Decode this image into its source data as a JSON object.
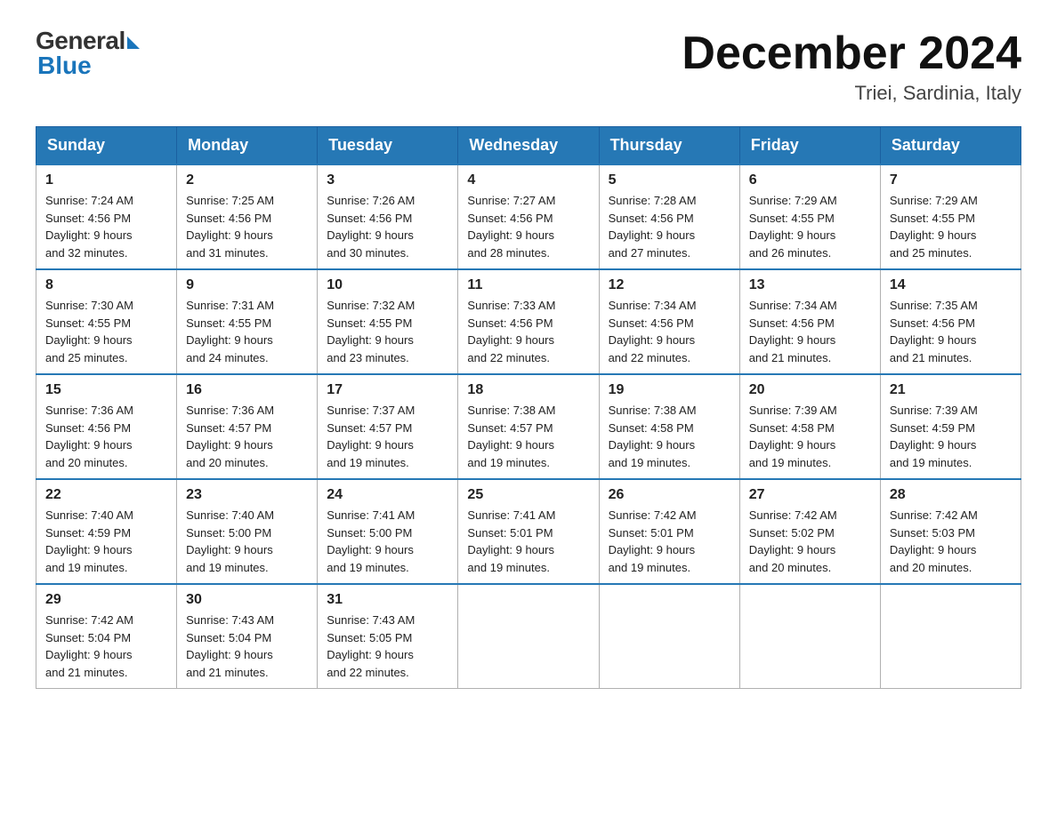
{
  "logo": {
    "general": "General",
    "blue": "Blue"
  },
  "title": "December 2024",
  "location": "Triei, Sardinia, Italy",
  "days_of_week": [
    "Sunday",
    "Monday",
    "Tuesday",
    "Wednesday",
    "Thursday",
    "Friday",
    "Saturday"
  ],
  "weeks": [
    [
      {
        "day": "1",
        "sunrise": "7:24 AM",
        "sunset": "4:56 PM",
        "daylight": "9 hours and 32 minutes."
      },
      {
        "day": "2",
        "sunrise": "7:25 AM",
        "sunset": "4:56 PM",
        "daylight": "9 hours and 31 minutes."
      },
      {
        "day": "3",
        "sunrise": "7:26 AM",
        "sunset": "4:56 PM",
        "daylight": "9 hours and 30 minutes."
      },
      {
        "day": "4",
        "sunrise": "7:27 AM",
        "sunset": "4:56 PM",
        "daylight": "9 hours and 28 minutes."
      },
      {
        "day": "5",
        "sunrise": "7:28 AM",
        "sunset": "4:56 PM",
        "daylight": "9 hours and 27 minutes."
      },
      {
        "day": "6",
        "sunrise": "7:29 AM",
        "sunset": "4:55 PM",
        "daylight": "9 hours and 26 minutes."
      },
      {
        "day": "7",
        "sunrise": "7:29 AM",
        "sunset": "4:55 PM",
        "daylight": "9 hours and 25 minutes."
      }
    ],
    [
      {
        "day": "8",
        "sunrise": "7:30 AM",
        "sunset": "4:55 PM",
        "daylight": "9 hours and 25 minutes."
      },
      {
        "day": "9",
        "sunrise": "7:31 AM",
        "sunset": "4:55 PM",
        "daylight": "9 hours and 24 minutes."
      },
      {
        "day": "10",
        "sunrise": "7:32 AM",
        "sunset": "4:55 PM",
        "daylight": "9 hours and 23 minutes."
      },
      {
        "day": "11",
        "sunrise": "7:33 AM",
        "sunset": "4:56 PM",
        "daylight": "9 hours and 22 minutes."
      },
      {
        "day": "12",
        "sunrise": "7:34 AM",
        "sunset": "4:56 PM",
        "daylight": "9 hours and 22 minutes."
      },
      {
        "day": "13",
        "sunrise": "7:34 AM",
        "sunset": "4:56 PM",
        "daylight": "9 hours and 21 minutes."
      },
      {
        "day": "14",
        "sunrise": "7:35 AM",
        "sunset": "4:56 PM",
        "daylight": "9 hours and 21 minutes."
      }
    ],
    [
      {
        "day": "15",
        "sunrise": "7:36 AM",
        "sunset": "4:56 PM",
        "daylight": "9 hours and 20 minutes."
      },
      {
        "day": "16",
        "sunrise": "7:36 AM",
        "sunset": "4:57 PM",
        "daylight": "9 hours and 20 minutes."
      },
      {
        "day": "17",
        "sunrise": "7:37 AM",
        "sunset": "4:57 PM",
        "daylight": "9 hours and 19 minutes."
      },
      {
        "day": "18",
        "sunrise": "7:38 AM",
        "sunset": "4:57 PM",
        "daylight": "9 hours and 19 minutes."
      },
      {
        "day": "19",
        "sunrise": "7:38 AM",
        "sunset": "4:58 PM",
        "daylight": "9 hours and 19 minutes."
      },
      {
        "day": "20",
        "sunrise": "7:39 AM",
        "sunset": "4:58 PM",
        "daylight": "9 hours and 19 minutes."
      },
      {
        "day": "21",
        "sunrise": "7:39 AM",
        "sunset": "4:59 PM",
        "daylight": "9 hours and 19 minutes."
      }
    ],
    [
      {
        "day": "22",
        "sunrise": "7:40 AM",
        "sunset": "4:59 PM",
        "daylight": "9 hours and 19 minutes."
      },
      {
        "day": "23",
        "sunrise": "7:40 AM",
        "sunset": "5:00 PM",
        "daylight": "9 hours and 19 minutes."
      },
      {
        "day": "24",
        "sunrise": "7:41 AM",
        "sunset": "5:00 PM",
        "daylight": "9 hours and 19 minutes."
      },
      {
        "day": "25",
        "sunrise": "7:41 AM",
        "sunset": "5:01 PM",
        "daylight": "9 hours and 19 minutes."
      },
      {
        "day": "26",
        "sunrise": "7:42 AM",
        "sunset": "5:01 PM",
        "daylight": "9 hours and 19 minutes."
      },
      {
        "day": "27",
        "sunrise": "7:42 AM",
        "sunset": "5:02 PM",
        "daylight": "9 hours and 20 minutes."
      },
      {
        "day": "28",
        "sunrise": "7:42 AM",
        "sunset": "5:03 PM",
        "daylight": "9 hours and 20 minutes."
      }
    ],
    [
      {
        "day": "29",
        "sunrise": "7:42 AM",
        "sunset": "5:04 PM",
        "daylight": "9 hours and 21 minutes."
      },
      {
        "day": "30",
        "sunrise": "7:43 AM",
        "sunset": "5:04 PM",
        "daylight": "9 hours and 21 minutes."
      },
      {
        "day": "31",
        "sunrise": "7:43 AM",
        "sunset": "5:05 PM",
        "daylight": "9 hours and 22 minutes."
      },
      null,
      null,
      null,
      null
    ]
  ],
  "labels": {
    "sunrise": "Sunrise:",
    "sunset": "Sunset:",
    "daylight": "Daylight:"
  }
}
